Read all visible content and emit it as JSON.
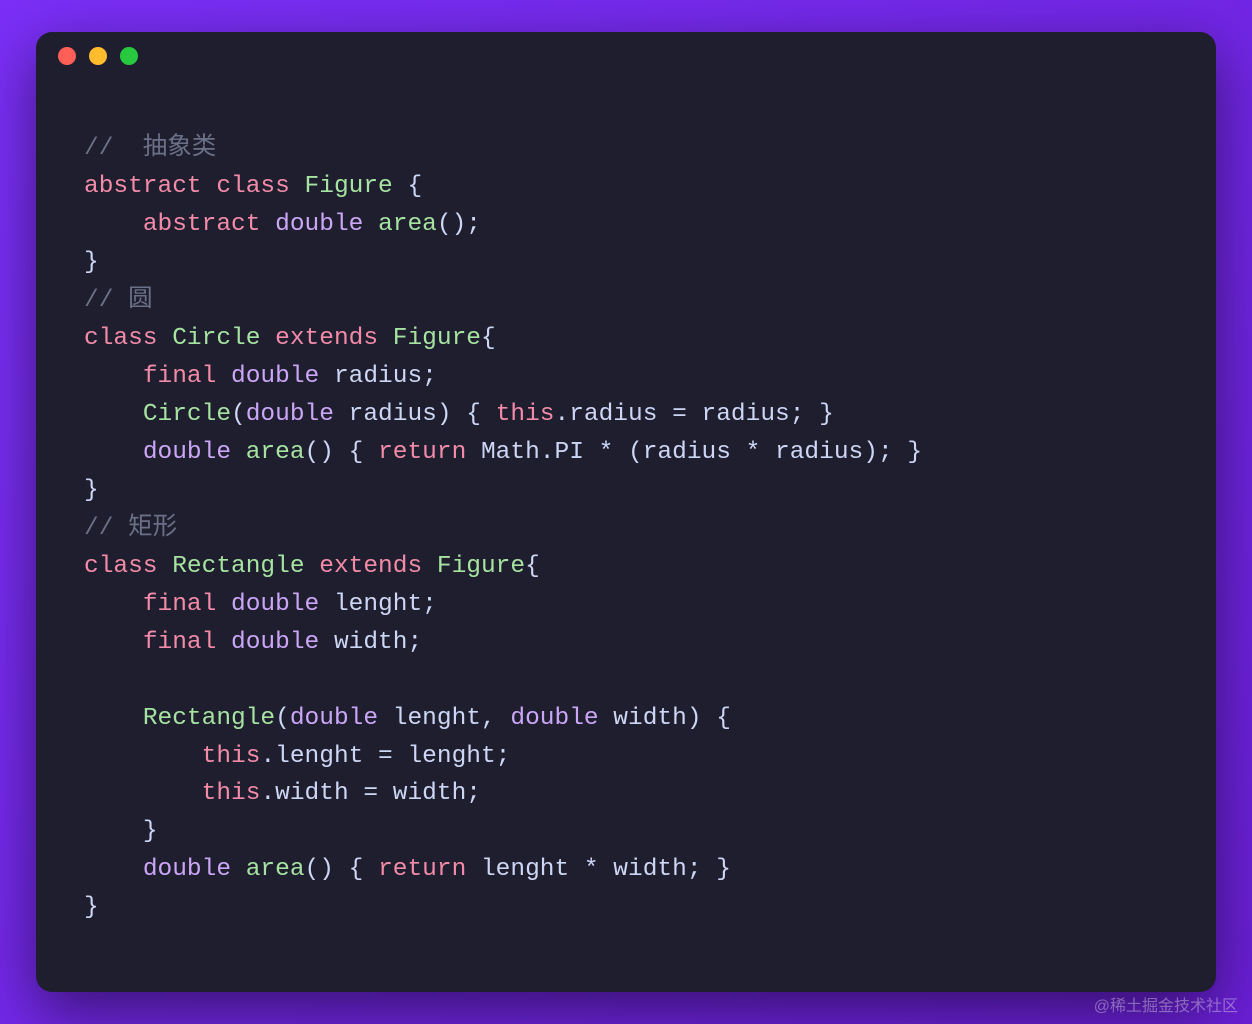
{
  "watermark": "@稀土掘金技术社区",
  "code": {
    "l1": {
      "comment": "//  抽象类"
    },
    "l2": {
      "kw1": "abstract",
      "kw2": "class",
      "cls": "Figure",
      "brace": " {"
    },
    "l3": {
      "indent": "    ",
      "kw1": "abstract",
      "type": "double",
      "method": "area",
      "rest": "();"
    },
    "l4": {
      "brace": "}"
    },
    "l5": {
      "comment": "// 圆"
    },
    "l6": {
      "kw": "class",
      "cls": "Circle",
      "ext": "extends",
      "sup": "Figure",
      "brace": "{"
    },
    "l7": {
      "indent": "    ",
      "kw": "final",
      "type": "double",
      "name": " radius;"
    },
    "l8": {
      "indent": "    ",
      "ctor": "Circle",
      "p1": "(",
      "ptype": "double",
      "pname": " radius) { ",
      "this": "this",
      "rest": ".radius = radius; }"
    },
    "l9": {
      "indent": "    ",
      "type": "double",
      "method": "area",
      "p": "() { ",
      "ret": "return",
      "rest": " Math.PI * (radius * radius); }"
    },
    "l10": {
      "brace": "}"
    },
    "l11": {
      "comment": "// 矩形"
    },
    "l12": {
      "kw": "class",
      "cls": "Rectangle",
      "ext": "extends",
      "sup": "Figure",
      "brace": "{"
    },
    "l13": {
      "indent": "    ",
      "kw": "final",
      "type": "double",
      "name": " lenght;"
    },
    "l14": {
      "indent": "    ",
      "kw": "final",
      "type": "double",
      "name": " width;"
    },
    "l15": {
      "blank": ""
    },
    "l16": {
      "indent": "    ",
      "ctor": "Rectangle",
      "p1": "(",
      "ptype1": "double",
      "pname1": " lenght, ",
      "ptype2": "double",
      "pname2": " width) {"
    },
    "l17": {
      "indent": "        ",
      "this": "this",
      "rest": ".lenght = lenght;"
    },
    "l18": {
      "indent": "        ",
      "this": "this",
      "rest": ".width = width;"
    },
    "l19": {
      "indent": "    ",
      "brace": "}"
    },
    "l20": {
      "indent": "    ",
      "type": "double",
      "method": "area",
      "p": "() { ",
      "ret": "return",
      "rest": " lenght * width; }"
    },
    "l21": {
      "brace": "}"
    }
  }
}
